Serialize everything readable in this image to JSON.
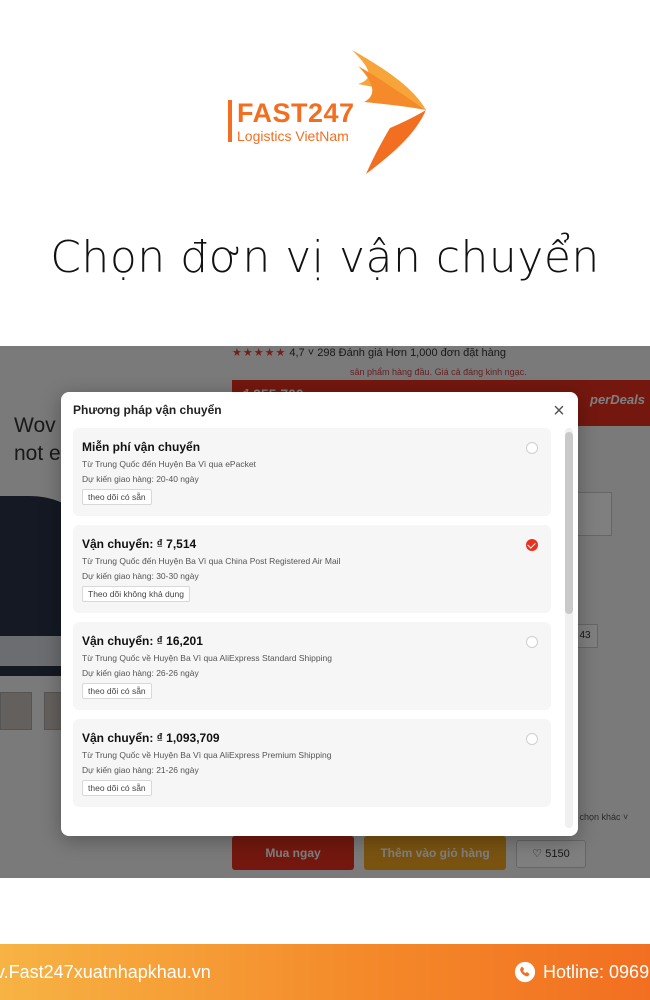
{
  "brand": {
    "name": "FAST247",
    "tagline": "Logistics VietNam",
    "color": "#f26f21"
  },
  "page_title": "Chọn đơn vị vận chuyển",
  "background": {
    "rating": "4,7",
    "stars": "★★★★★",
    "reviews": "298 Đánh giá",
    "orders": "Hơn 1,000 đơn đặt hàng",
    "subline": "sản phẩm hàng đầu. Giá cả đáng kinh ngạc.",
    "price": "₫ 255,700",
    "superdeals": "perDeals",
    "product_text": "Wov\nnot e",
    "size_box": "43",
    "more_choices": "a chọn khác",
    "buy_label": "Mua ngay",
    "cart_label": "Thêm vào giỏ hàng",
    "wish_count": "5150"
  },
  "modal": {
    "title": "Phương pháp vận chuyển",
    "close_icon": "close-icon",
    "options": [
      {
        "title": "Miễn phí vận chuyển",
        "route": "Từ Trung Quốc đến Huyện Ba Vì qua ePacket",
        "eta": "Dự kiến giao hàng: 20-40 ngày",
        "tracking": "theo dõi có sẵn",
        "selected": false
      },
      {
        "title": "Vận chuyển: ₫ 7,514",
        "route": "Từ Trung Quốc đến Huyện Ba Vì qua China Post Registered Air Mail",
        "eta": "Dự kiến giao hàng: 30-30 ngày",
        "tracking": "Theo dõi không khả dụng",
        "selected": true
      },
      {
        "title": "Vận chuyển: ₫ 16,201",
        "route": "Từ Trung Quốc về Huyện Ba Vì qua AliExpress Standard Shipping",
        "eta": "Dự kiến giao hàng: 26-26 ngày",
        "tracking": "theo dõi có sẵn",
        "selected": false
      },
      {
        "title": "Vận chuyển: ₫ 1,093,709",
        "route": "Từ Trung Quốc về Huyện Ba Vì qua AliExpress Premium Shipping",
        "eta": "Dự kiến giao hàng: 21-26 ngày",
        "tracking": "theo dõi có sẵn",
        "selected": false
      }
    ]
  },
  "footer": {
    "website": "v.Fast247xuatnhapkhau.vn",
    "hotline": "Hotline: 0969",
    "phone_icon": "phone-icon"
  },
  "colors": {
    "accent_red": "#e8311f",
    "accent_orange": "#f5a623"
  }
}
